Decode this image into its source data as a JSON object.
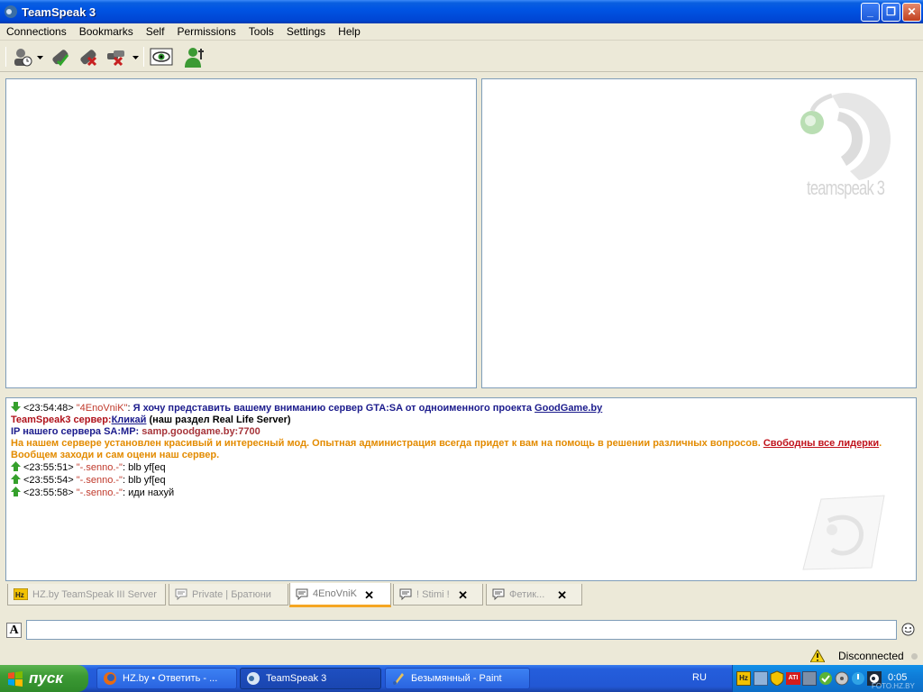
{
  "window": {
    "title": "TeamSpeak 3"
  },
  "menu": [
    "Connections",
    "Bookmarks",
    "Self",
    "Permissions",
    "Tools",
    "Settings",
    "Help"
  ],
  "logo": {
    "text": "teamspeak 3"
  },
  "chat": {
    "line1": {
      "time": "<23:54:48>",
      "nick": "\"4EnoVniK\"",
      "text": "Я хочу представить вашему вниманию сервер GTA:SA от одноименного проекта",
      "link": "GoodGame.by"
    },
    "line2": {
      "label": "TeamSpeak3 сервер:",
      "link": "Кликай",
      "text": " (наш раздел Real Life Server)"
    },
    "line3": {
      "label": "IP нашего сервера SA:MP:",
      "value": " samp.goodgame.by:7700"
    },
    "line4": {
      "text": "На нашем сервере установлен красивый и интересный мод. Опытная администрация всегда придет к вам на помощь в решении различных вопросов.",
      "link": "Свободны все лидерки",
      "text2": ". Вообщем заходи и сам оцени наш сервер."
    },
    "line5": {
      "time": "<23:55:51>",
      "nick": "\"-.senno.-\"",
      "text": ": blb yf[eq"
    },
    "line6": {
      "time": "<23:55:54>",
      "nick": "\"-.senno.-\"",
      "text": ": blb yf[eq"
    },
    "line7": {
      "time": "<23:55:58>",
      "nick": "\"-.senno.-\"",
      "text": ": иди нахуй"
    }
  },
  "tabs": [
    {
      "label": "HZ.by TeamSpeak III Server"
    },
    {
      "label": "Private |  Братюни"
    },
    {
      "label": "4EnoVniK"
    },
    {
      "label": "! Stimi !"
    },
    {
      "label": "Фетик..."
    }
  ],
  "input": {
    "value": ""
  },
  "status": {
    "text": "Disconnected"
  },
  "taskbar": {
    "start": "пуск",
    "tasks": [
      "HZ.by • Ответить - ...",
      "TeamSpeak 3",
      "Безымянный - Paint"
    ],
    "lang": "RU",
    "clock": "0:05",
    "watermark": "FOTO.HZ.BY"
  },
  "colors": {
    "accent": "#f5a623",
    "titlebar": "#0054e3",
    "taskbar": "#245edc"
  }
}
